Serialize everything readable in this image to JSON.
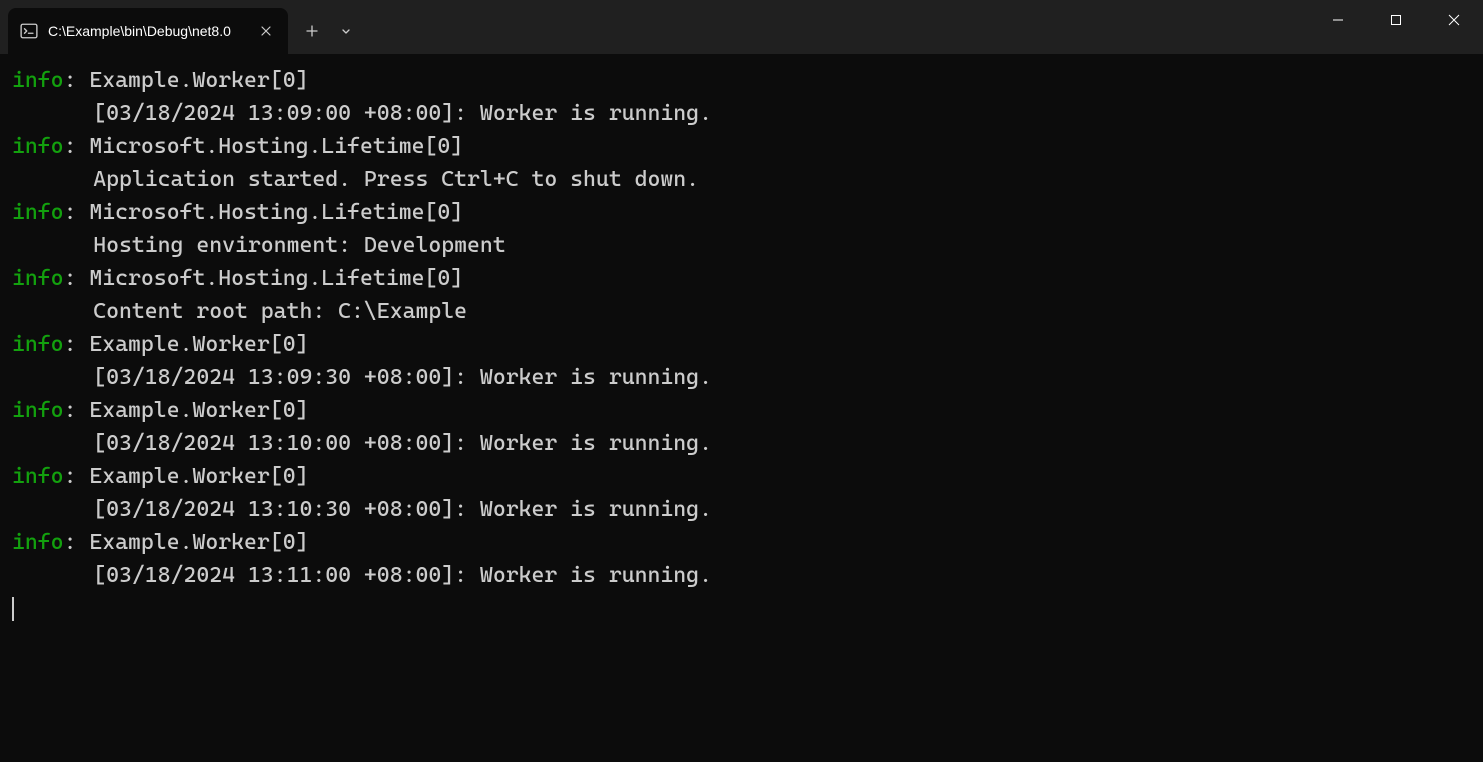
{
  "window": {
    "tab_title": "C:\\Example\\bin\\Debug\\net8.0"
  },
  "colors": {
    "info_level": "#13a10e",
    "text": "#cccccc",
    "background": "#0c0c0c"
  },
  "log_entries": [
    {
      "level": "info",
      "source": "Example.Worker[0]",
      "message": "[03/18/2024 13:09:00 +08:00]: Worker is running."
    },
    {
      "level": "info",
      "source": "Microsoft.Hosting.Lifetime[0]",
      "message": "Application started. Press Ctrl+C to shut down."
    },
    {
      "level": "info",
      "source": "Microsoft.Hosting.Lifetime[0]",
      "message": "Hosting environment: Development"
    },
    {
      "level": "info",
      "source": "Microsoft.Hosting.Lifetime[0]",
      "message": "Content root path: C:\\Example"
    },
    {
      "level": "info",
      "source": "Example.Worker[0]",
      "message": "[03/18/2024 13:09:30 +08:00]: Worker is running."
    },
    {
      "level": "info",
      "source": "Example.Worker[0]",
      "message": "[03/18/2024 13:10:00 +08:00]: Worker is running."
    },
    {
      "level": "info",
      "source": "Example.Worker[0]",
      "message": "[03/18/2024 13:10:30 +08:00]: Worker is running."
    },
    {
      "level": "info",
      "source": "Example.Worker[0]",
      "message": "[03/18/2024 13:11:00 +08:00]: Worker is running."
    }
  ]
}
